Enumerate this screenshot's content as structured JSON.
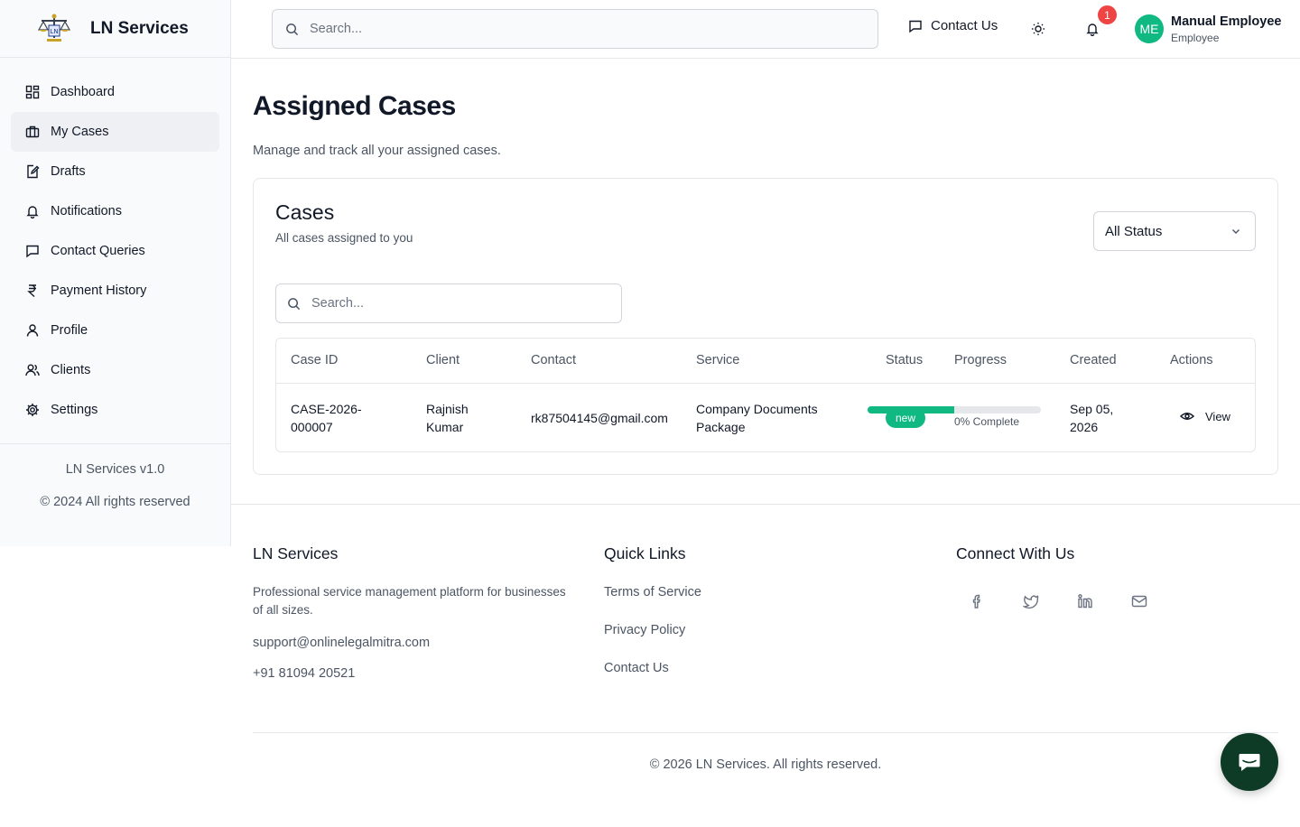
{
  "brand": {
    "name": "LN Services",
    "logo_icon": "scales-of-justice-logo"
  },
  "sidebar": {
    "items": [
      {
        "label": "Dashboard",
        "icon": "dashboard-icon",
        "active": false
      },
      {
        "label": "My Cases",
        "icon": "briefcase-icon",
        "active": true
      },
      {
        "label": "Drafts",
        "icon": "draft-edit-icon",
        "active": false
      },
      {
        "label": "Notifications",
        "icon": "bell-icon",
        "active": false
      },
      {
        "label": "Contact Queries",
        "icon": "message-icon",
        "active": false
      },
      {
        "label": "Payment History",
        "icon": "rupee-icon",
        "active": false
      },
      {
        "label": "Profile",
        "icon": "user-icon",
        "active": false
      },
      {
        "label": "Clients",
        "icon": "users-icon",
        "active": false
      },
      {
        "label": "Settings",
        "icon": "gear-icon",
        "active": false
      }
    ],
    "version": "LN Services v1.0",
    "copyright": "© 2024 All rights reserved"
  },
  "topbar": {
    "search_placeholder": "Search...",
    "contact_label": "Contact Us",
    "notification_count": "1",
    "avatar_initials": "ME",
    "user_name": "Manual Employee",
    "user_role": "Employee"
  },
  "page": {
    "title": "Assigned Cases",
    "subtitle": "Manage and track all your assigned cases."
  },
  "cases_card": {
    "title": "Cases",
    "subtitle": "All cases assigned to you",
    "status_filter": "All Status",
    "search_placeholder": "Search...",
    "columns": [
      "Case ID",
      "Client",
      "Contact",
      "Service",
      "Status",
      "Progress",
      "Created",
      "Actions"
    ],
    "rows": [
      {
        "case_id": "CASE-2026-000007",
        "client": "Rajnish Kumar",
        "contact": "rk87504145@gmail.com",
        "service": "Company Documents Package",
        "status": "new",
        "progress_fill": 0.5,
        "progress_text": "0% Complete",
        "created": "Sep 05, 2026",
        "action_label": "View"
      }
    ]
  },
  "footer": {
    "about": {
      "title": "LN Services",
      "description": "Professional service management platform for businesses of all sizes.",
      "email": "support@onlinelegalmitra.com",
      "phone": "+91 81094 20521"
    },
    "quick_links": {
      "title": "Quick Links",
      "links": [
        "Terms of Service",
        "Privacy Policy",
        "Contact Us"
      ]
    },
    "connect": {
      "title": "Connect With Us",
      "icons": [
        "facebook-icon",
        "twitter-icon",
        "linkedin-icon",
        "mail-icon"
      ]
    },
    "copyright": "© 2026 LN Services. All rights reserved."
  },
  "colors": {
    "accent": "#10b981",
    "badge": "#ef4444",
    "chat_fab": "#0e3b26"
  }
}
